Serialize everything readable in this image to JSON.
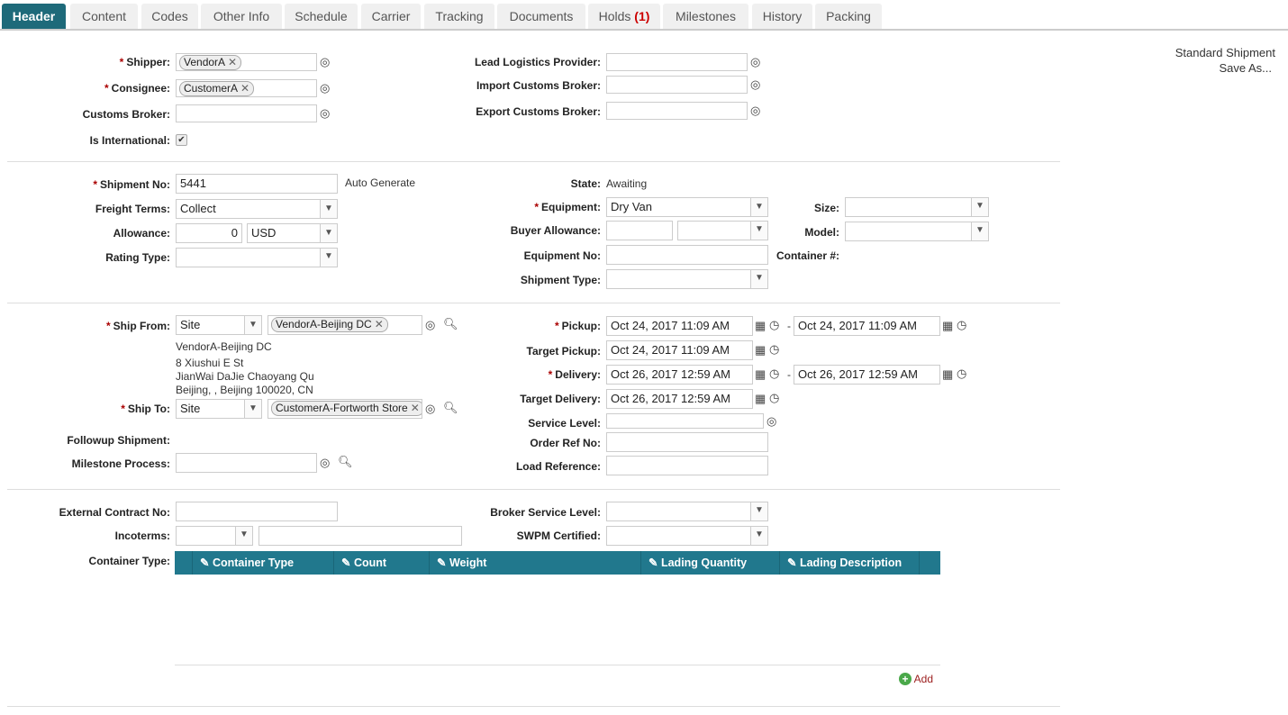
{
  "tabs": [
    "Header",
    "Content",
    "Codes",
    "Other Info",
    "Schedule",
    "Carrier",
    "Tracking",
    "Documents",
    "Holds",
    "Milestones",
    "History",
    "Packing"
  ],
  "holds_count": "(1)",
  "template": {
    "name": "Standard Shipment",
    "save_as": "Save As..."
  },
  "parties": {
    "shipper_label": "Shipper:",
    "shipper": "VendorA",
    "consignee_label": "Consignee:",
    "consignee": "CustomerA",
    "customs_broker_label": "Customs Broker:",
    "is_international_label": "Is International:",
    "is_international": true,
    "llp_label": "Lead Logistics Provider:",
    "import_label": "Import Customs Broker:",
    "export_label": "Export Customs Broker:"
  },
  "shipment": {
    "no_label": "Shipment No:",
    "no": "5441",
    "auto_generate": "Auto Generate",
    "freight_label": "Freight Terms:",
    "freight": "Collect",
    "allowance_label": "Allowance:",
    "allowance": "0",
    "currency": "USD",
    "rating_label": "Rating Type:",
    "state_label": "State:",
    "state": "Awaiting",
    "equipment_label": "Equipment:",
    "equipment": "Dry Van",
    "buyer_allowance_label": "Buyer Allowance:",
    "equipment_no_label": "Equipment No:",
    "shipment_type_label": "Shipment Type:",
    "size_label": "Size:",
    "model_label": "Model:",
    "container_label": "Container #:"
  },
  "route": {
    "ship_from_label": "Ship From:",
    "ship_from_type": "Site",
    "ship_from": "VendorA-Beijing DC",
    "address": [
      "VendorA-Beijing DC",
      "8 Xiushui E St",
      "JianWai DaJie Chaoyang Qu",
      "Beijing, , Beijing 100020, CN"
    ],
    "ship_to_label": "Ship To:",
    "ship_to_type": "Site",
    "ship_to": "CustomerA-Fortworth Store",
    "followup_label": "Followup Shipment:",
    "milestone_label": "Milestone Process:",
    "pickup_label": "Pickup:",
    "pickup_from": "Oct 24, 2017 11:09 AM",
    "pickup_to": "Oct 24, 2017 11:09 AM",
    "target_pickup_label": "Target Pickup:",
    "target_pickup": "Oct 24, 2017 11:09 AM",
    "delivery_label": "Delivery:",
    "delivery_from": "Oct 26, 2017 12:59 AM",
    "delivery_to": "Oct 26, 2017 12:59 AM",
    "target_delivery_label": "Target Delivery:",
    "target_delivery": "Oct 26, 2017 12:59 AM",
    "service_level_label": "Service Level:",
    "order_ref_label": "Order Ref No:",
    "load_ref_label": "Load Reference:",
    "dash": "-"
  },
  "contract": {
    "external_label": "External Contract No:",
    "incoterms_label": "Incoterms:",
    "container_type_label": "Container Type:",
    "broker_service_label": "Broker Service Level:",
    "swpm_label": "SWPM Certified:"
  },
  "table": {
    "columns": [
      "Container Type",
      "Count",
      "Weight",
      "Lading Quantity",
      "Lading Description"
    ],
    "add": "Add"
  },
  "colors": {
    "accent": "#1e6a7a",
    "table_header": "#21788d",
    "required": "#a00"
  }
}
